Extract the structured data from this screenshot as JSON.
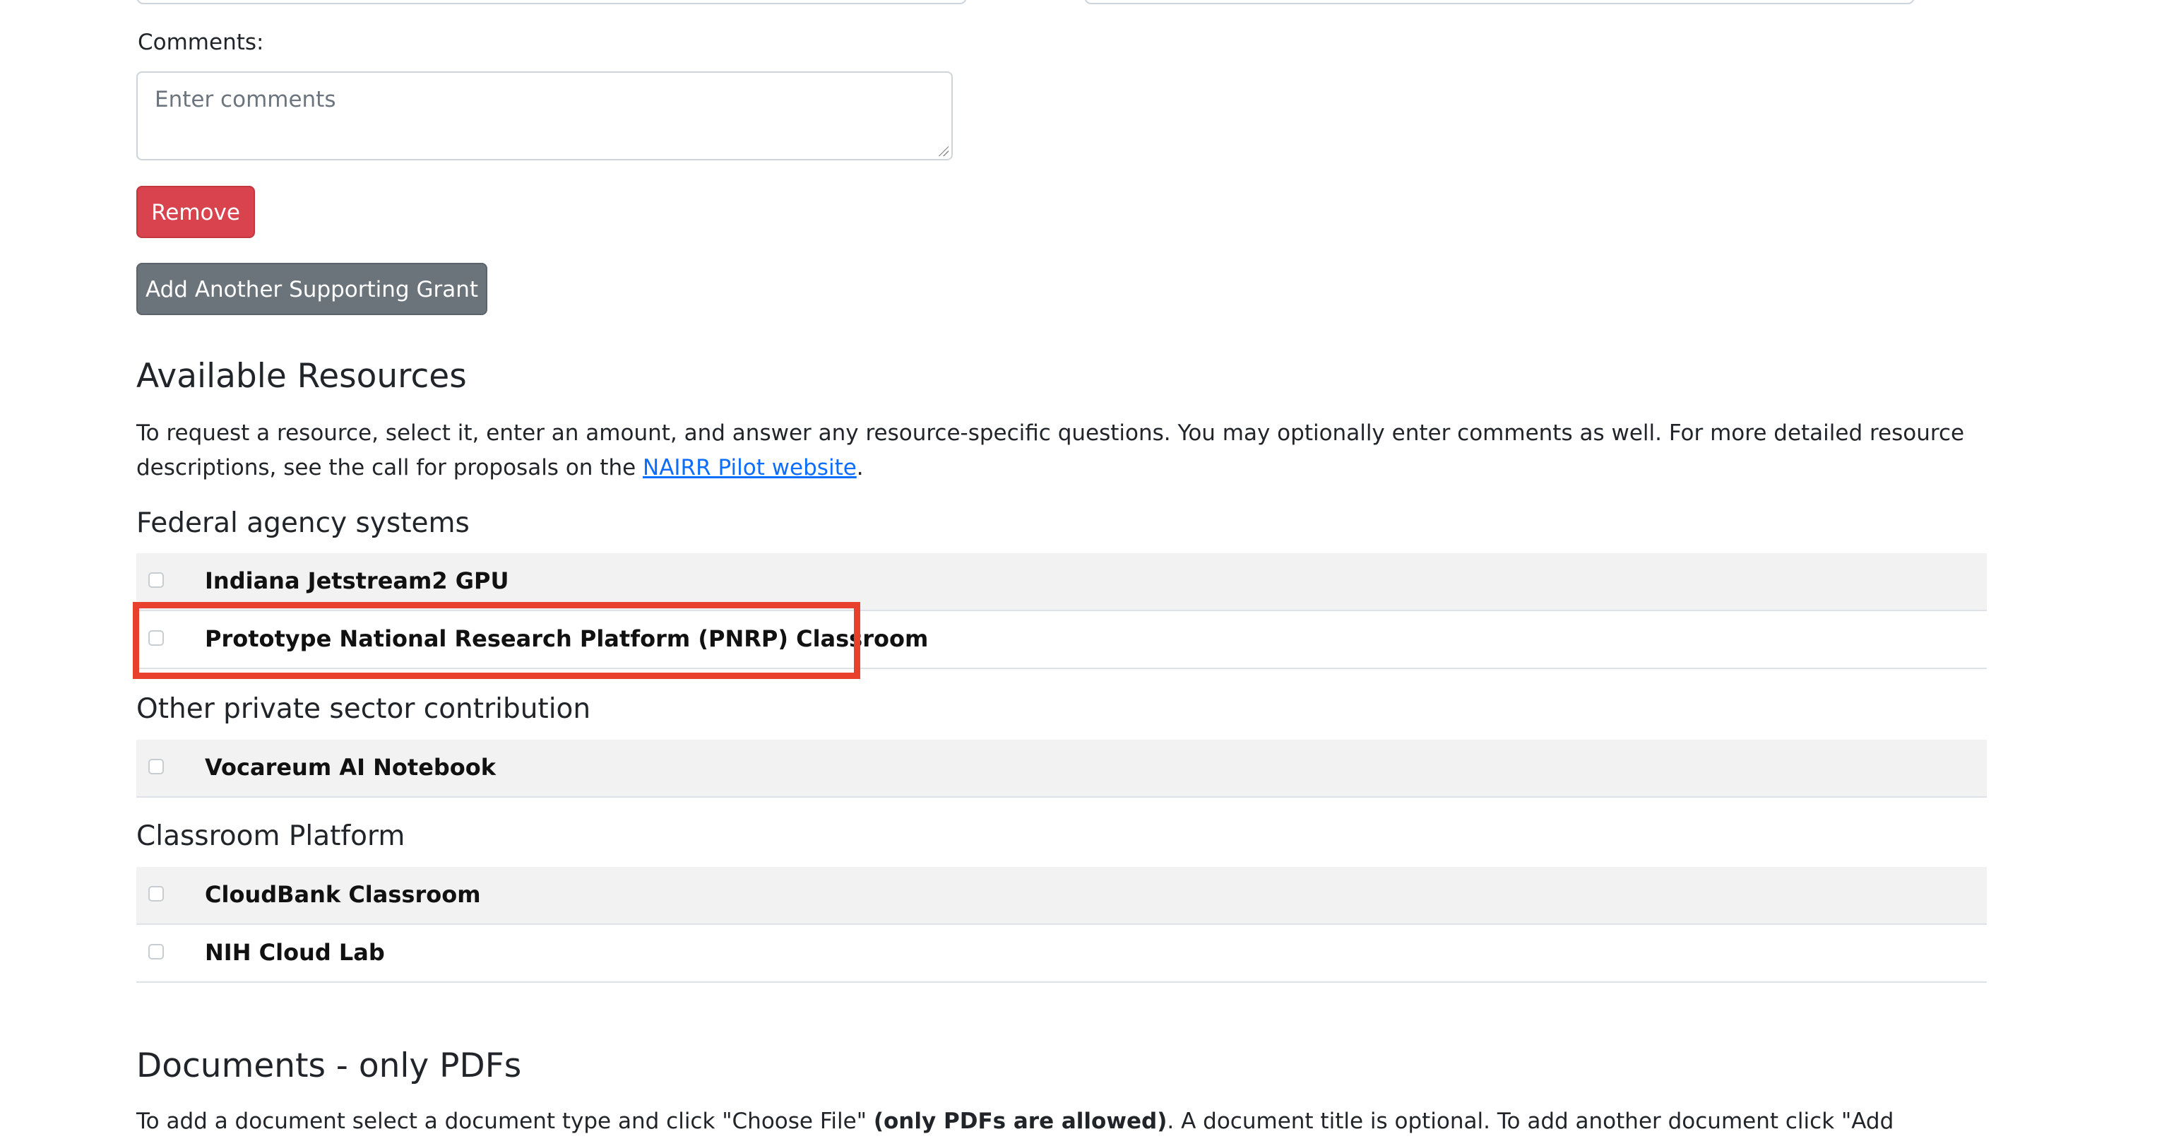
{
  "comments": {
    "label": "Comments:",
    "placeholder": "Enter comments"
  },
  "buttons": {
    "remove": "Remove",
    "add_grant": "Add Another Supporting Grant"
  },
  "resources": {
    "title": "Available Resources",
    "intro_before_link": "To request a resource, select it, enter an amount, and answer any resource-specific questions. You may optionally enter comments as well. For more detailed resource descriptions, see the call for proposals on the ",
    "link_text": "NAIRR Pilot website",
    "intro_after_link": ".",
    "groups": [
      {
        "heading": "Federal agency systems",
        "items": [
          {
            "label": "Indiana Jetstream2 GPU",
            "checked": false
          },
          {
            "label": "Prototype National Research Platform (PNRP) Classroom",
            "checked": false
          }
        ]
      },
      {
        "heading": "Other private sector contribution",
        "items": [
          {
            "label": "Vocareum AI Notebook",
            "checked": false
          }
        ]
      },
      {
        "heading": "Classroom Platform",
        "items": [
          {
            "label": "CloudBank Classroom",
            "checked": false
          },
          {
            "label": "NIH Cloud Lab",
            "checked": false
          }
        ]
      }
    ]
  },
  "documents": {
    "title": "Documents - only PDFs",
    "instructions_part1": "To add a document select a document type and click \"Choose File\" ",
    "instructions_bold": "(only PDFs are allowed)",
    "instructions_part2": ". A document title is optional. To add another document click \"Add Another Document\". To remove a document click \"Remove\"."
  },
  "colors": {
    "danger": "#d9434d",
    "secondary": "#6b737b",
    "link": "#0d6efd",
    "highlight": "#e8402c"
  }
}
